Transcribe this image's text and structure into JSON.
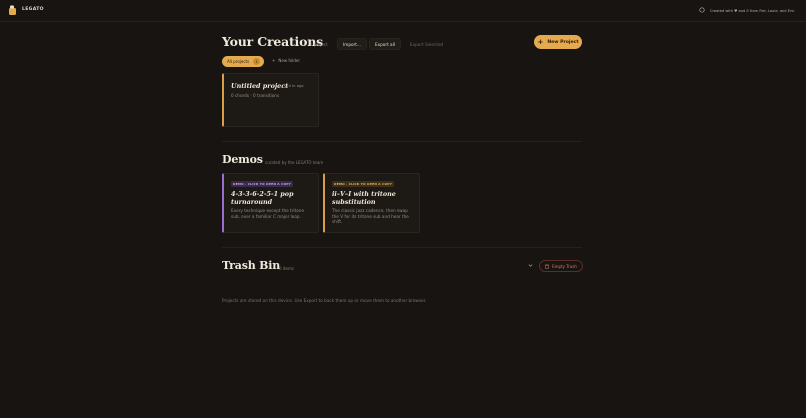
{
  "app": {
    "brand": "LEGATO",
    "credit": "Created with ♥ and Ƨ from Fee, Louie, and Eric"
  },
  "creations": {
    "title": "Your Creations",
    "count": "1 project",
    "import_label": "Import...",
    "export_all_label": "Export all",
    "export_selected_label": "Export Selected",
    "new_project_label": "New Project",
    "filter_all_label": "All projects",
    "filter_all_count": "1",
    "new_folder_label": "New folder",
    "projects": [
      {
        "title": "Untitled project",
        "age": "· 10 hr ago",
        "meta": "0 chords · 0 transitions"
      }
    ]
  },
  "demos": {
    "title": "Demos",
    "subtitle": "curated by the LEGATO team",
    "items": [
      {
        "badge": "DEMO · CLICK TO OPEN A COPY",
        "title_line1": "4-3-3-6-2-5-1 pop",
        "title_line2": "turnaround",
        "desc": "Every technique except the tritone sub, over a familiar C major loop.",
        "accent": "#9a6fd0"
      },
      {
        "badge": "DEMO · CLICK TO OPEN A COPY",
        "title_line1": "ii–V–I with tritone",
        "title_line2": "substitution",
        "desc": "The classic jazz cadence, then swap the V for its tritone sub and hear the shift.",
        "accent": "#d99e46"
      }
    ]
  },
  "trash": {
    "title": "Trash Bin",
    "count": "0 items",
    "empty_label": "Empty Trash"
  },
  "footer": {
    "note": "Projects are stored on this device. Use Export to back them up or move them to another browser."
  },
  "colors": {
    "background": "#171411",
    "accent": "#e5a94e",
    "danger": "#d97a63"
  }
}
